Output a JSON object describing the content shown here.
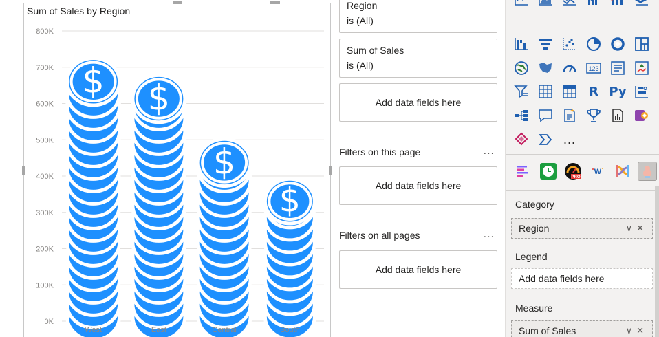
{
  "visual": {
    "title": "Sum of Sales by Region"
  },
  "chart_data": {
    "type": "bar",
    "title": "Sum of Sales by Region",
    "categories": [
      "West",
      "East",
      "Central",
      "South"
    ],
    "values": [
      725000,
      678000,
      502000,
      392000
    ],
    "y_ticks": [
      "0K",
      "100K",
      "200K",
      "300K",
      "400K",
      "500K",
      "600K",
      "700K",
      "800K"
    ],
    "ylim": [
      0,
      800000
    ],
    "grid": true,
    "bar_color": "#1e90ff",
    "icon": "dollar-coin-icon"
  },
  "filters": {
    "region_card": {
      "name": "Region",
      "value": "is (All)"
    },
    "sales_card": {
      "name": "Sum of Sales",
      "value": "is (All)"
    },
    "add_visual": "Add data fields here",
    "page_header": "Filters on this page",
    "add_page": "Add data fields here",
    "all_header": "Filters on all pages",
    "add_all": "Add data fields here",
    "more": "..."
  },
  "viz": {
    "icons_row1": [
      "line-chart-icon",
      "area-chart-icon",
      "stacked-area-chart-icon",
      "line-clustered-column-icon",
      "line-stacked-column-icon",
      "ribbon-chart-icon"
    ],
    "icons_row2": [
      "waterfall-chart-icon",
      "funnel-chart-icon",
      "scatter-chart-icon",
      "pie-chart-icon",
      "donut-chart-icon",
      "treemap-icon"
    ],
    "icons_row3": [
      "map-icon",
      "filled-map-icon",
      "gauge-icon",
      "card-icon",
      "multi-row-card-icon",
      "kpi-icon"
    ],
    "icons_row4_labels": {
      "r": "R",
      "py": "Py"
    },
    "icons_row4": [
      "slicer-icon",
      "table-icon",
      "matrix-icon",
      "r-visual-icon",
      "python-visual-icon",
      "key-influencers-icon"
    ],
    "icons_row5": [
      "decomposition-tree-icon",
      "qa-icon",
      "smart-narrative-icon",
      "trophy-icon",
      "paginated-report-icon",
      "power-apps-icon"
    ],
    "icons_row6": [
      "power-automate-icon",
      "arcgis-icon",
      "more-visuals-icon"
    ],
    "more": "...",
    "custom_badge": "PRO",
    "custom_w": "W",
    "custom_icons": [
      "custom-bars-icon",
      "custom-clock-icon",
      "custom-pro-gauge-icon",
      "custom-word-cloud-icon",
      "custom-sankey-icon",
      "custom-infographic-icon"
    ],
    "category_label": "Category",
    "category_value": "Region",
    "legend_label": "Legend",
    "legend_value": "Add data fields here",
    "measure_label": "Measure",
    "measure_value": "Sum of Sales",
    "accent": "#1e90ff"
  }
}
